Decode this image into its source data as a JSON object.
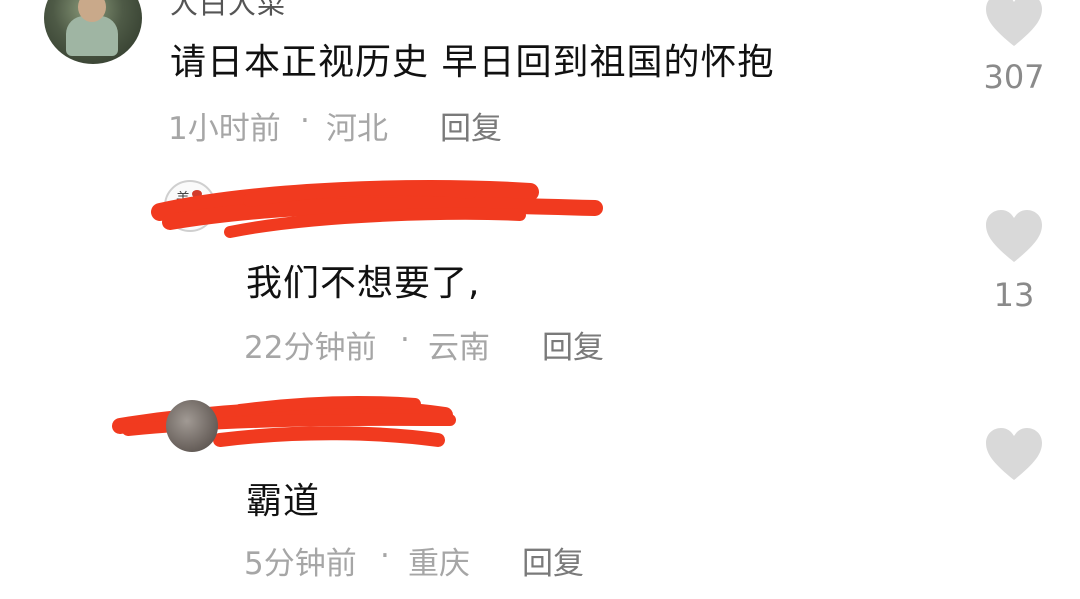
{
  "comments": [
    {
      "username": "大白大菜",
      "text": "请日本正视历史  早日回到祖国的怀抱",
      "time": "1小时前",
      "separator": "·",
      "location": "河北",
      "reply_label": "回复",
      "likes": "307"
    },
    {
      "text": "我们不想要了,",
      "time": "22分钟前",
      "separator": "·",
      "location": "云南",
      "reply_label": "回复",
      "likes": "13"
    },
    {
      "text": "霸道",
      "time": "5分钟前",
      "separator": "·",
      "location": "重庆",
      "reply_label": "回复",
      "likes": ""
    }
  ],
  "icons": {
    "like": "heart-icon"
  },
  "colors": {
    "heart": "#d9d9d9",
    "redaction": "#f13a1f",
    "meta_text": "#a6a6a6"
  }
}
